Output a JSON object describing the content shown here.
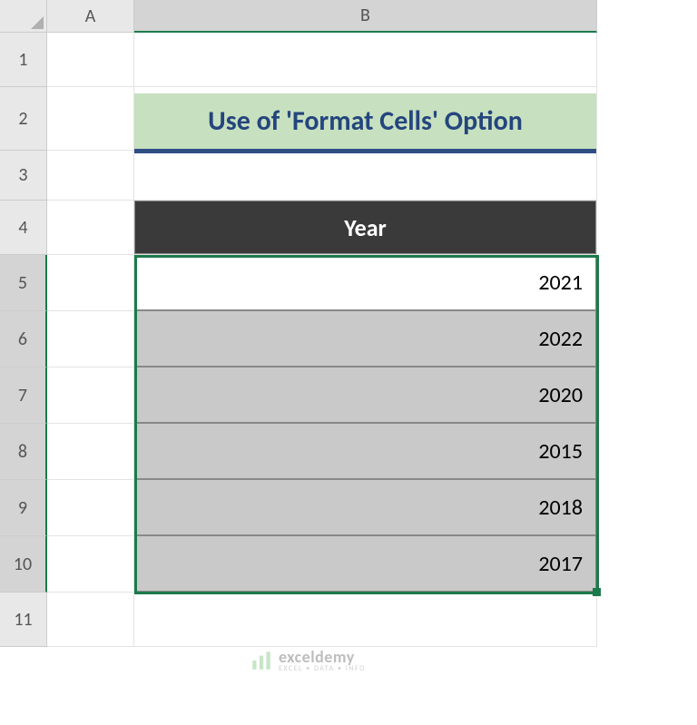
{
  "columns": {
    "A": "A",
    "B": "B"
  },
  "rows": {
    "1": "1",
    "2": "2",
    "3": "3",
    "4": "4",
    "5": "5",
    "6": "6",
    "7": "7",
    "8": "8",
    "9": "9",
    "10": "10",
    "11": "11"
  },
  "title": "Use of 'Format Cells' Option",
  "table_header": "Year",
  "data": [
    "2021",
    "2022",
    "2020",
    "2015",
    "2018",
    "2017"
  ],
  "watermark": {
    "brand": "exceldemy",
    "prefix_icon": "chart-bars",
    "tagline": "EXCEL • DATA • INFO"
  },
  "chart_data": {
    "type": "table",
    "columns": [
      "Year"
    ],
    "rows": [
      [
        2021
      ],
      [
        2022
      ],
      [
        2020
      ],
      [
        2015
      ],
      [
        2018
      ],
      [
        2017
      ]
    ]
  }
}
